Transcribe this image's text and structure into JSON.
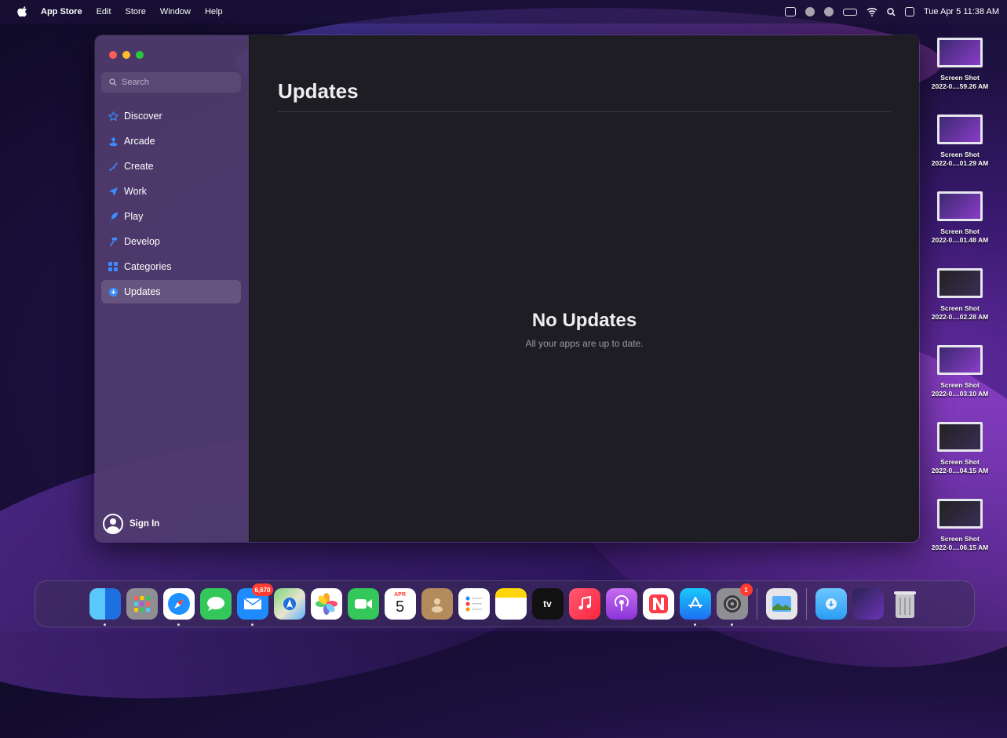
{
  "menubar": {
    "app_name": "App Store",
    "menus": [
      "Edit",
      "Store",
      "Window",
      "Help"
    ],
    "clock": "Tue Apr 5  11:38 AM"
  },
  "sidebar": {
    "search_placeholder": "Search",
    "items": [
      {
        "label": "Discover",
        "icon": "star-icon"
      },
      {
        "label": "Arcade",
        "icon": "joystick-icon"
      },
      {
        "label": "Create",
        "icon": "paintbrush-icon"
      },
      {
        "label": "Work",
        "icon": "paperplane-icon"
      },
      {
        "label": "Play",
        "icon": "rocket-icon"
      },
      {
        "label": "Develop",
        "icon": "hammer-icon"
      },
      {
        "label": "Categories",
        "icon": "grid-icon"
      },
      {
        "label": "Updates",
        "icon": "download-icon",
        "selected": true
      }
    ],
    "sign_in": "Sign In"
  },
  "main": {
    "title": "Updates",
    "empty_title": "No Updates",
    "empty_subtitle": "All your apps are up to date."
  },
  "desktop_files": [
    {
      "line1": "Screen Shot",
      "line2": "2022-0....59.26 AM"
    },
    {
      "line1": "Screen Shot",
      "line2": "2022-0....01.29 AM"
    },
    {
      "line1": "Screen Shot",
      "line2": "2022-0....01.48 AM"
    },
    {
      "line1": "Screen Shot",
      "line2": "2022-0....02.28 AM"
    },
    {
      "line1": "Screen Shot",
      "line2": "2022-0....03.10 AM"
    },
    {
      "line1": "Screen Shot",
      "line2": "2022-0....04.15 AM"
    },
    {
      "line1": "Screen Shot",
      "line2": "2022-0....06.15 AM"
    }
  ],
  "dock": {
    "mail_badge": "6,670",
    "settings_badge": "1",
    "calendar_month": "APR",
    "calendar_day": "5",
    "tv_label": "tv"
  },
  "colors": {
    "accent": "#3b8cff",
    "sidebar_bg": "#50406e",
    "main_bg": "#1f1d24"
  }
}
